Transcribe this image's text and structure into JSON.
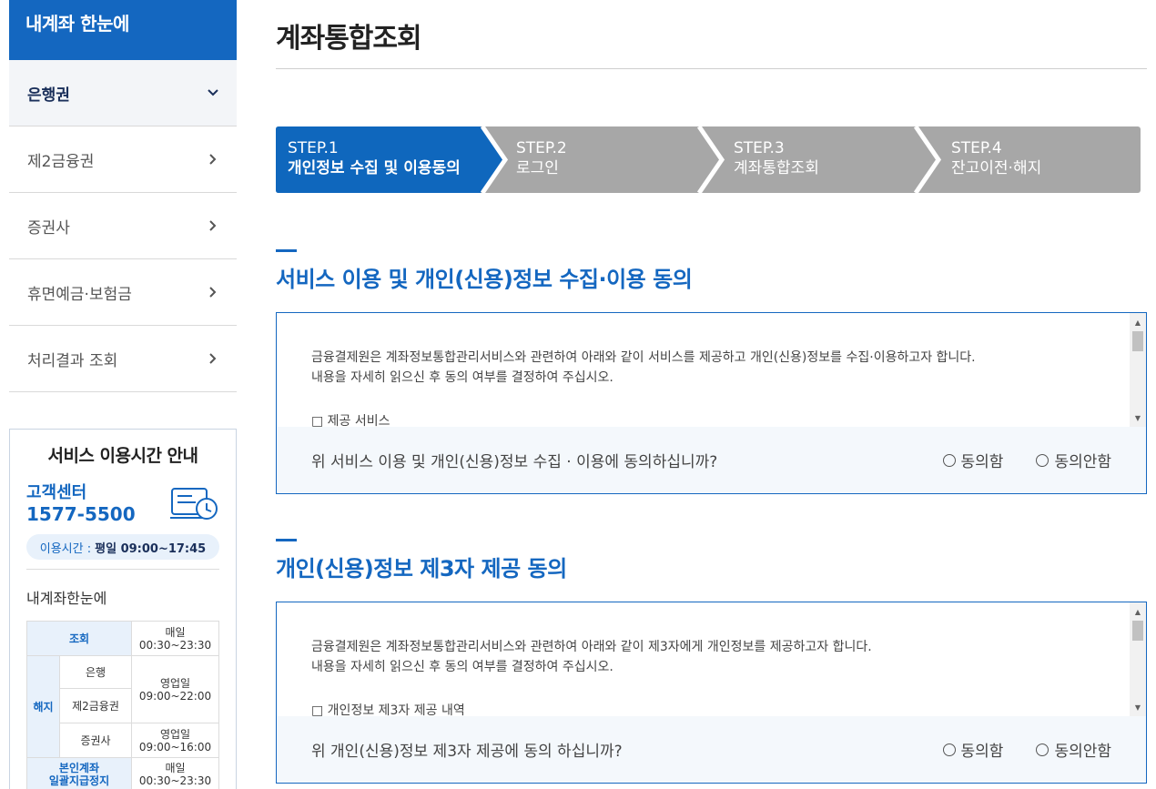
{
  "sidebar": {
    "title": "내계좌 한눈에",
    "items": [
      {
        "label": "은행권",
        "active": true
      },
      {
        "label": "제2금융권",
        "active": false
      },
      {
        "label": "증권사",
        "active": false
      },
      {
        "label": "휴면예금·보험금",
        "active": false
      },
      {
        "label": "처리결과 조회",
        "active": false
      }
    ]
  },
  "hours": {
    "title": "서비스 이용시간 안내",
    "cc_label": "고객센터",
    "cc_phone": "1577-5500",
    "time_label": "이용시간 :",
    "time_value": "평일 09:00~17:45",
    "subtitle": "내계좌한눈에",
    "table": {
      "r1_label": "조회",
      "r1_time_a": "매일",
      "r1_time_b": "00:30~23:30",
      "cancel_label": "해지",
      "bank": "은행",
      "second": "제2금융권",
      "bank_time_a": "영업일",
      "bank_time_b": "09:00~22:00",
      "sec": "증권사",
      "sec_time_a": "영업일",
      "sec_time_b": "09:00~16:00",
      "self_a": "본인계좌",
      "self_b": "일괄지급정지",
      "self_time_a": "매일",
      "self_time_b": "00:30~23:30"
    }
  },
  "page": {
    "title": "계좌통합조회"
  },
  "steps": [
    {
      "num": "STEP.1",
      "label": "개인정보 수집 및 이용동의",
      "active": true
    },
    {
      "num": "STEP.2",
      "label": "로그인",
      "active": false
    },
    {
      "num": "STEP.3",
      "label": "계좌통합조회",
      "active": false
    },
    {
      "num": "STEP.4",
      "label": "잔고이전·해지",
      "active": false
    }
  ],
  "section1": {
    "title": "서비스 이용 및 개인(신용)정보 수집·이용 동의",
    "line1": "금융결제원은 계좌정보통합관리서비스와 관련하여 아래와 같이 서비스를 제공하고 개인(신용)정보를 수집·이용하고자 합니다.",
    "line2": "내용을 자세히 읽으신 후 동의 여부를 결정하여 주십시오.",
    "line3": "□ 제공 서비스",
    "question": "위 서비스 이용 및 개인(신용)정보 수집 · 이용에 동의하십니까?",
    "agree": "동의함",
    "disagree": "동의안함"
  },
  "section2": {
    "title": "개인(신용)정보 제3자 제공 동의",
    "line1": "금융결제원은 계좌정보통합관리서비스와 관련하여 아래와 같이 제3자에게 개인정보를 제공하고자 합니다.",
    "line2": "내용을 자세히 읽으신 후 동의 여부를 결정하여 주십시오.",
    "line3": "□ 개인정보 제3자 제공 내역",
    "question": "위 개인(신용)정보 제3자 제공에 동의 하십니까?",
    "agree": "동의함",
    "disagree": "동의안함"
  },
  "colors": {
    "primary": "#1467c0",
    "step_inactive": "#a7a7a7",
    "step_active": "#0f67bd"
  }
}
